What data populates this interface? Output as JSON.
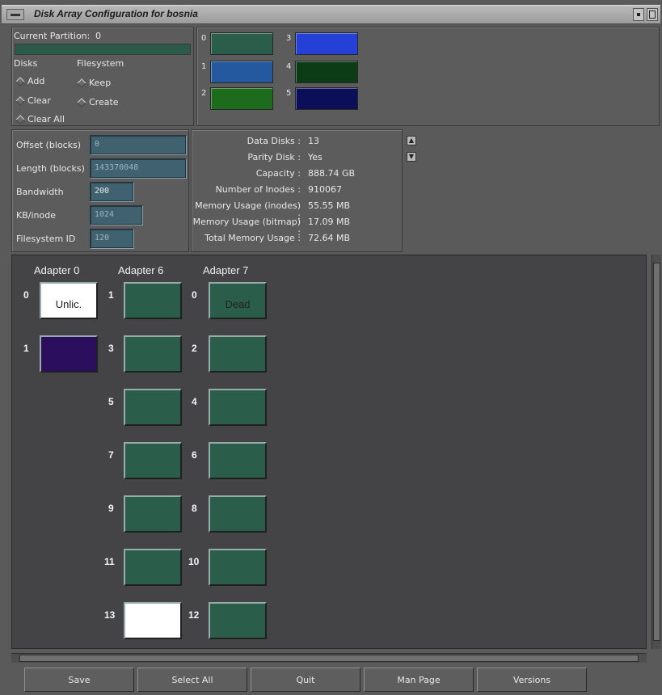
{
  "window": {
    "title": "Disk Array Configuration for bosnia"
  },
  "partition": {
    "current_label": "Current Partition:",
    "current_value": "0",
    "disks_label": "Disks",
    "filesystem_label": "Filesystem",
    "disks_options": [
      "Add",
      "Clear",
      "Clear All"
    ],
    "filesystem_options": [
      "Keep",
      "Create"
    ]
  },
  "swatches": [
    {
      "num": "0",
      "color": "#2b5e4a"
    },
    {
      "num": "1",
      "color": "#2459a0"
    },
    {
      "num": "2",
      "color": "#1d6b1d"
    },
    {
      "num": "3",
      "color": "#2440d6"
    },
    {
      "num": "4",
      "color": "#0c3c15"
    },
    {
      "num": "5",
      "color": "#0b0f5a"
    }
  ],
  "fields": [
    {
      "label": "Offset (blocks)",
      "value": "0"
    },
    {
      "label": "Length (blocks)",
      "value": "143370048"
    },
    {
      "label": "Bandwidth",
      "value": "200"
    },
    {
      "label": "KB/inode",
      "value": "1024"
    },
    {
      "label": "Filesystem ID",
      "value": "120"
    }
  ],
  "info": [
    {
      "key": "Data Disks :",
      "value": "13"
    },
    {
      "key": "Parity Disk :",
      "value": "Yes"
    },
    {
      "key": "Capacity :",
      "value": "888.74 GB"
    },
    {
      "key": "Number of Inodes :",
      "value": "910067"
    },
    {
      "key": "Memory Usage (inodes) :",
      "value": "55.55 MB"
    },
    {
      "key": "Memory Usage (bitmap) :",
      "value": "17.09 MB"
    },
    {
      "key": "Total Memory Usage   :",
      "value": "72.64 MB"
    }
  ],
  "adapters": [
    {
      "name": "Adapter 0",
      "disks": [
        {
          "slot": "0",
          "label": "Unlic.",
          "color": "white"
        },
        {
          "slot": "1",
          "label": "",
          "color": "purple"
        }
      ]
    },
    {
      "name": "Adapter 6",
      "disks": [
        {
          "slot": "1",
          "label": "",
          "color": "green"
        },
        {
          "slot": "3",
          "label": "",
          "color": "green"
        },
        {
          "slot": "5",
          "label": "",
          "color": "green"
        },
        {
          "slot": "7",
          "label": "",
          "color": "green"
        },
        {
          "slot": "9",
          "label": "",
          "color": "green"
        },
        {
          "slot": "11",
          "label": "",
          "color": "green"
        },
        {
          "slot": "13",
          "label": "",
          "color": "white"
        }
      ]
    },
    {
      "name": "Adapter 7",
      "disks": [
        {
          "slot": "0",
          "label": "Dead",
          "color": "green"
        },
        {
          "slot": "2",
          "label": "",
          "color": "green"
        },
        {
          "slot": "4",
          "label": "",
          "color": "green"
        },
        {
          "slot": "6",
          "label": "",
          "color": "green"
        },
        {
          "slot": "8",
          "label": "",
          "color": "green"
        },
        {
          "slot": "10",
          "label": "",
          "color": "green"
        },
        {
          "slot": "12",
          "label": "",
          "color": "green"
        }
      ]
    }
  ],
  "buttons": [
    "Save",
    "Select All",
    "Quit",
    "Man Page",
    "Versions"
  ]
}
